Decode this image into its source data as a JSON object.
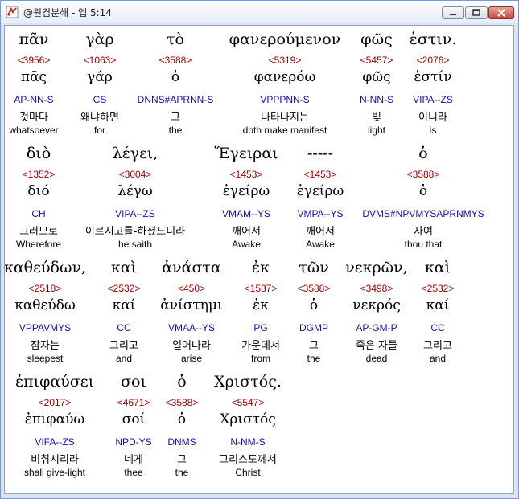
{
  "window": {
    "title": "@원겸분해 - 엡 5:14",
    "buttons": {
      "minimize": "minimize",
      "maximize": "maximize",
      "close": "close"
    }
  },
  "colors": {
    "code": "#990000",
    "parse": "#1010b0",
    "text": "#000000",
    "background": "#ffffff"
  },
  "lines": [
    [
      {
        "greek": "πᾶν",
        "code": "<3956>",
        "lemma": "πᾶς",
        "parse": "AP-NN-S",
        "korean": "것마다",
        "english": "whatsoever"
      },
      {
        "greek": "γὰρ",
        "code": "<1063>",
        "lemma": "γάρ",
        "parse": "CS",
        "korean": "왜냐하면",
        "english": "for"
      },
      {
        "greek": "τὸ",
        "code": "<3588>",
        "lemma": "ὁ",
        "parse": "DNNS#APRNN-S",
        "korean": "그",
        "english": "the"
      },
      {
        "greek": "φανερούμενον",
        "code": "<5319>",
        "lemma": "φανερόω",
        "parse": "VPPPNN-S",
        "korean": "나타나지는",
        "english": "doth make manifest"
      },
      {
        "greek": "φῶς",
        "code": "<5457>",
        "lemma": "φῶς",
        "parse": "N-NN-S",
        "korean": "빛",
        "english": "light"
      },
      {
        "greek": "ἐστιν.",
        "code": "<2076>",
        "lemma": "ἐστίν",
        "parse": "VIPA--ZS",
        "korean": "이니라",
        "english": "is"
      }
    ],
    [
      {
        "greek": "διὸ",
        "code": "<1352>",
        "lemma": "διό",
        "parse": "CH",
        "korean": "그러므로",
        "english": "Wherefore"
      },
      {
        "greek": "λέγει,",
        "code": "<3004>",
        "lemma": "λέγω",
        "parse": "VIPA--ZS",
        "korean": "이르시고를-하셨느니라",
        "english": "he saith"
      },
      {
        "greek": "Ἔγειραι",
        "code": "<1453>",
        "lemma": "ἐγείρω",
        "parse": "VMAM--YS",
        "korean": "깨어서",
        "english": "Awake"
      },
      {
        "greek": "-----",
        "code": "<1453>",
        "lemma": "ἐγείρω",
        "parse": "VMPA--YS",
        "korean": "깨어서",
        "english": "Awake"
      },
      {
        "greek": "ὁ",
        "code": "<3588>",
        "lemma": "ὁ",
        "parse": "DVMS#NPVMYSAPRNMYS",
        "korean": "자여",
        "english": "thou that"
      }
    ],
    [
      {
        "greek": "καθεύδων,",
        "code": "<2518>",
        "lemma": "καθεύδω",
        "parse": "VPPAVMYS",
        "korean": "잠자는",
        "english": "sleepest"
      },
      {
        "greek": "καὶ",
        "code": "<2532>",
        "lemma": "καί",
        "parse": "CC",
        "korean": "그리고",
        "english": "and"
      },
      {
        "greek": "ἀνάστα",
        "code": "<450>",
        "lemma": "ἀνίστημι",
        "parse": "VMAA--YS",
        "korean": "일어나라",
        "english": "arise"
      },
      {
        "greek": "ἐκ",
        "code": "<1537>",
        "lemma": "ἐκ",
        "parse": "PG",
        "korean": "가운데서",
        "english": "from"
      },
      {
        "greek": "τῶν",
        "code": "<3588>",
        "lemma": "ὁ",
        "parse": "DGMP",
        "korean": "그",
        "english": "the"
      },
      {
        "greek": "νεκρῶν,",
        "code": "<3498>",
        "lemma": "νεκρός",
        "parse": "AP-GM-P",
        "korean": "죽은 자들",
        "english": "dead"
      },
      {
        "greek": "καὶ",
        "code": "<2532>",
        "lemma": "καί",
        "parse": "CC",
        "korean": "그리고",
        "english": "and"
      }
    ],
    [
      {
        "greek": "ἐπιφαύσει",
        "code": "<2017>",
        "lemma": "ἐπιφαύω",
        "parse": "VIFA--ZS",
        "korean": "비취시리라",
        "english": "shall give-light"
      },
      {
        "greek": "σοι",
        "code": "<4671>",
        "lemma": "σοί",
        "parse": "NPD-YS",
        "korean": "네게",
        "english": "thee"
      },
      {
        "greek": "ὁ",
        "code": "<3588>",
        "lemma": "ὁ",
        "parse": "DNMS",
        "korean": "그",
        "english": "the"
      },
      {
        "greek": "Χριστός.",
        "code": "<5547>",
        "lemma": "Χριστός",
        "parse": "N-NM-S",
        "korean": "그리스도께서",
        "english": "Christ"
      }
    ]
  ]
}
